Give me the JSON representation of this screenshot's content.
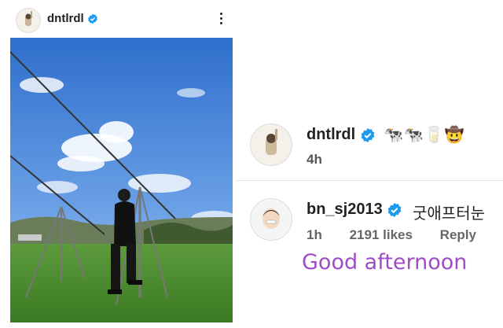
{
  "post": {
    "username": "dntlrdl",
    "verified": true,
    "more_icon": "more-vertical-icon"
  },
  "comments": [
    {
      "username": "dntlrdl",
      "verified": true,
      "text": "🐄🐄🥛🤠",
      "time": "4h"
    },
    {
      "username": "bn_sj2013",
      "verified": true,
      "text": "굿애프터눈",
      "time": "1h",
      "likes": "2191 likes",
      "reply_label": "Reply"
    }
  ],
  "translation": "Good afternoon",
  "colors": {
    "verified": "#1d9bf0",
    "translation": "#a04cc8",
    "sky": "#4f86d8",
    "grass": "#4d8f2f"
  }
}
